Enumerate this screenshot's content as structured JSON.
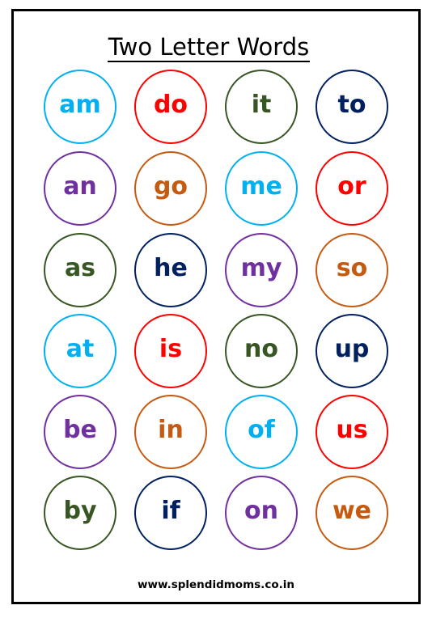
{
  "title": "Two Letter Words",
  "footer": "www.splendidmoms.co.in",
  "colors": {
    "cyan": "#00B0F0",
    "red": "#FF0000",
    "green": "#375623",
    "navy": "#002060",
    "purple": "#7030A0",
    "orange": "#C55A11"
  },
  "rows": [
    [
      {
        "word": "am",
        "color": "cyan"
      },
      {
        "word": "do",
        "color": "red"
      },
      {
        "word": "it",
        "color": "green"
      },
      {
        "word": "to",
        "color": "navy"
      }
    ],
    [
      {
        "word": "an",
        "color": "purple"
      },
      {
        "word": "go",
        "color": "orange"
      },
      {
        "word": "me",
        "color": "cyan"
      },
      {
        "word": "or",
        "color": "red"
      }
    ],
    [
      {
        "word": "as",
        "color": "green"
      },
      {
        "word": "he",
        "color": "navy"
      },
      {
        "word": "my",
        "color": "purple"
      },
      {
        "word": "so",
        "color": "orange"
      }
    ],
    [
      {
        "word": "at",
        "color": "cyan"
      },
      {
        "word": "is",
        "color": "red"
      },
      {
        "word": "no",
        "color": "green"
      },
      {
        "word": "up",
        "color": "navy"
      }
    ],
    [
      {
        "word": "be",
        "color": "purple"
      },
      {
        "word": "in",
        "color": "orange"
      },
      {
        "word": "of",
        "color": "cyan"
      },
      {
        "word": "us",
        "color": "red"
      }
    ],
    [
      {
        "word": "by",
        "color": "green"
      },
      {
        "word": "if",
        "color": "navy"
      },
      {
        "word": "on",
        "color": "purple"
      },
      {
        "word": "we",
        "color": "orange"
      }
    ]
  ]
}
